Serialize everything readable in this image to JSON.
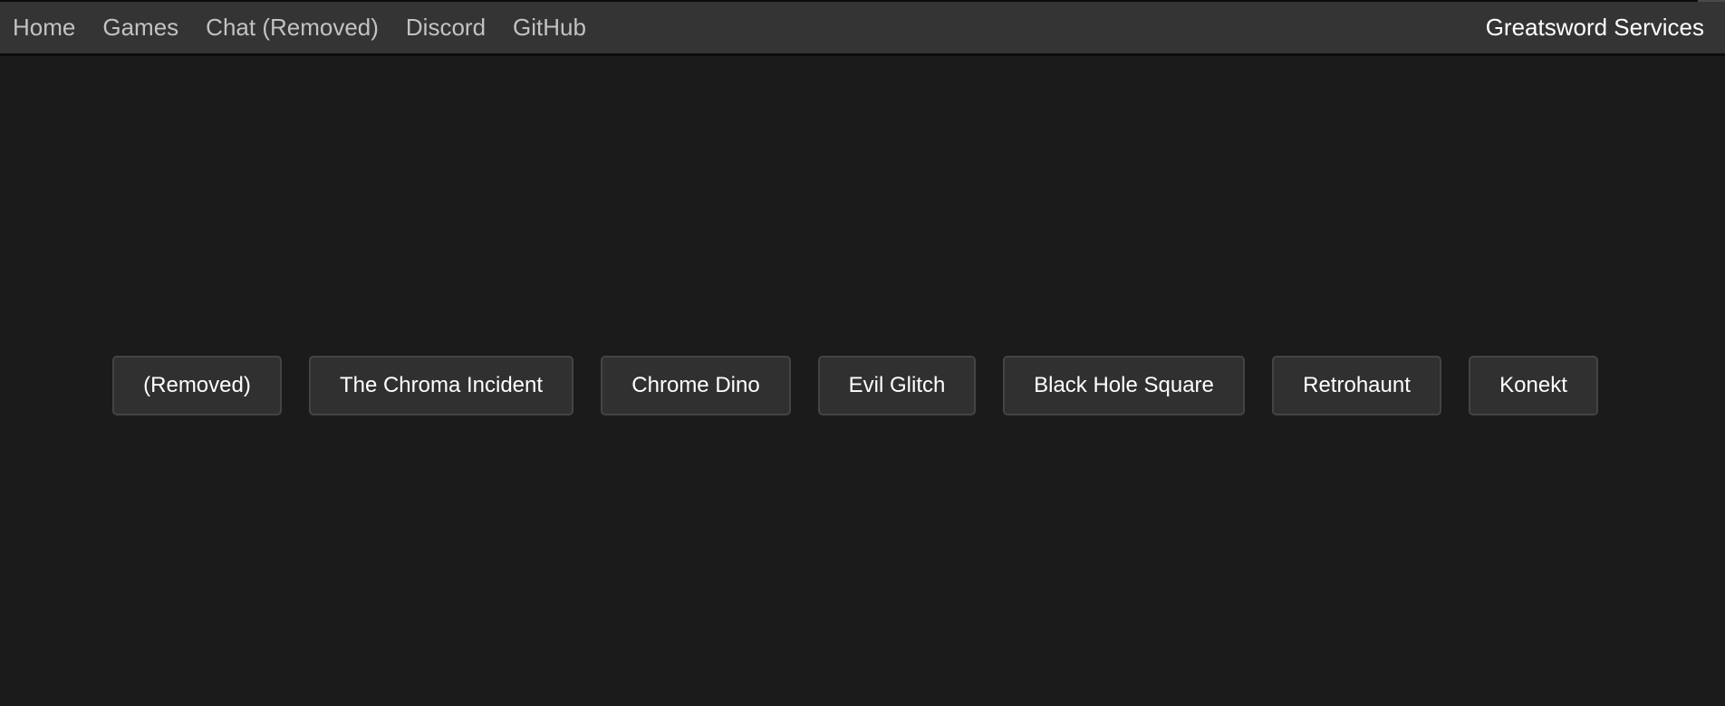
{
  "nav": {
    "links": [
      "Home",
      "Games",
      "Chat (Removed)",
      "Discord",
      "GitHub"
    ],
    "brand": "Greatsword Services"
  },
  "games": [
    "(Removed)",
    "The Chroma Incident",
    "Chrome Dino",
    "Evil Glitch",
    "Black Hole Square",
    "Retrohaunt",
    "Konekt"
  ],
  "colors": {
    "background": "#1b1b1b",
    "navbar": "#343434",
    "button": "#303030",
    "button_border": "#444444",
    "nav_text": "#c2c2c2",
    "brand_text": "#ffffff"
  }
}
